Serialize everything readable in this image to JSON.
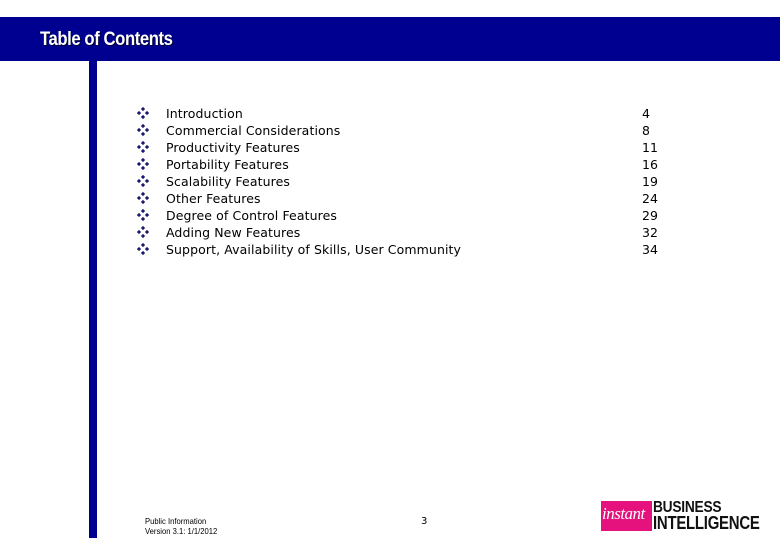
{
  "header": {
    "title": "Table of Contents"
  },
  "colors": {
    "header_bar": "#000090",
    "logo_accent": "#e5127d"
  },
  "toc": {
    "bullet_icon": "diamond-bullet-icon",
    "items": [
      {
        "label": "Introduction",
        "page": "4"
      },
      {
        "label": "Commercial Considerations",
        "page": "8"
      },
      {
        "label": "Productivity Features",
        "page": "11"
      },
      {
        "label": "Portability Features",
        "page": "16"
      },
      {
        "label": "Scalability Features",
        "page": "19"
      },
      {
        "label": "Other Features",
        "page": "24"
      },
      {
        "label": "Degree of Control Features",
        "page": "29"
      },
      {
        "label": "Adding New Features",
        "page": "32"
      },
      {
        "label": "Support, Availability of Skills, User Community",
        "page": "34"
      }
    ]
  },
  "footer": {
    "line1": "Public Information",
    "line2": "Version 3.1: 1/1/2012",
    "page_number": "3"
  },
  "logo": {
    "word1": "instant",
    "word2": "BUSINESS",
    "word3": "INTELLIGENCE"
  }
}
